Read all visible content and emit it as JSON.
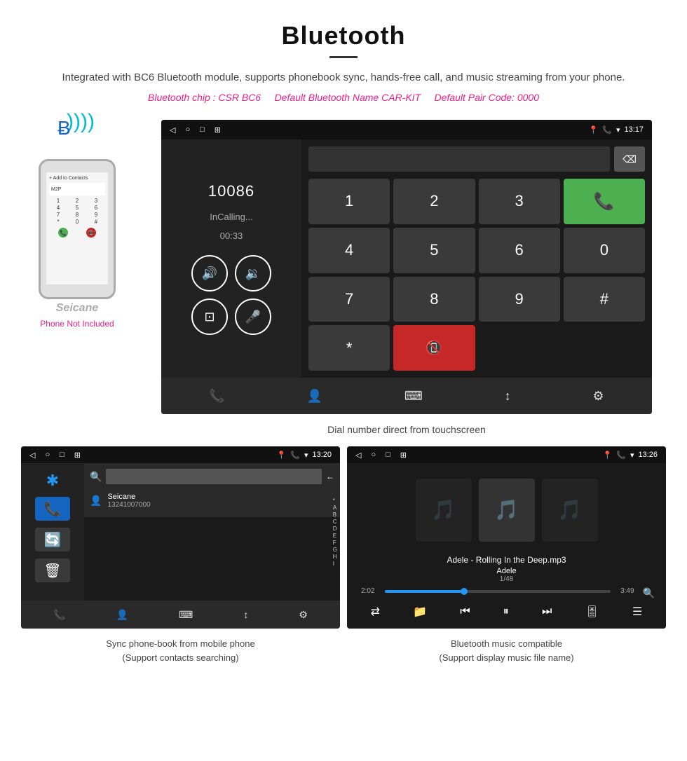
{
  "page": {
    "title": "Bluetooth",
    "divider": true,
    "description": "Integrated with BC6 Bluetooth module, supports phonebook sync, hands-free call, and music streaming from your phone.",
    "specs": "(Bluetooth chip : CSR BC6     Default Bluetooth Name CAR-KIT     Default Pair Code: 0000)",
    "specs_parts": {
      "chip": "Bluetooth chip : CSR BC6",
      "name": "Default Bluetooth Name CAR-KIT",
      "code": "Default Pair Code: 0000"
    }
  },
  "main_screenshot": {
    "status_bar": {
      "time": "13:17",
      "icons_left": [
        "◁",
        "○",
        "□",
        "⊞"
      ]
    },
    "dial": {
      "number": "10086",
      "status": "InCalling...",
      "timer": "00:33"
    },
    "keypad": {
      "keys": [
        "1",
        "2",
        "3",
        "*",
        "4",
        "5",
        "6",
        "0",
        "7",
        "8",
        "9",
        "#"
      ]
    }
  },
  "caption_main": "Dial number direct from touchscreen",
  "phone_not_included": "Phone Not Included",
  "phonebook_screenshot": {
    "status_bar_time": "13:20",
    "contact_name": "Seicane",
    "contact_number": "13241007000",
    "letters": [
      "*",
      "A",
      "B",
      "C",
      "D",
      "E",
      "F",
      "G",
      "H",
      "I"
    ]
  },
  "music_screenshot": {
    "status_bar_time": "13:26",
    "song": "Adele - Rolling In the Deep.mp3",
    "artist": "Adele",
    "track_info": "1/48",
    "time_current": "2:02",
    "time_total": "3:49"
  },
  "caption_phonebook": "Sync phone-book from mobile phone\n(Support contacts searching)",
  "caption_music": "Bluetooth music compatible\n(Support display music file name)",
  "seicane": "Seicane",
  "colors": {
    "accent_pink": "#e91e8c",
    "accent_green": "#4caf50",
    "accent_red": "#c62828",
    "accent_blue": "#2196f3"
  }
}
